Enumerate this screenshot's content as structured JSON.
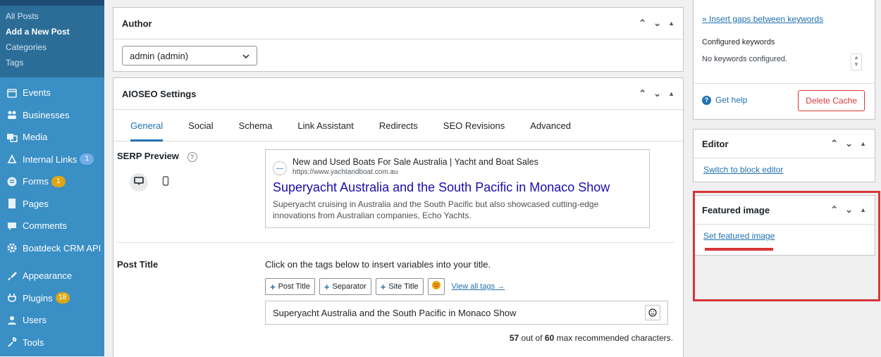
{
  "sidebar": {
    "submenu": [
      "All Posts",
      "Add a New Post",
      "Categories",
      "Tags"
    ],
    "items": [
      {
        "label": "Events",
        "icon": "calendar-icon"
      },
      {
        "label": "Businesses",
        "icon": "businesses-icon"
      },
      {
        "label": "Media",
        "icon": "media-icon"
      },
      {
        "label": "Internal Links",
        "icon": "link-icon",
        "badge": "1"
      },
      {
        "label": "Forms",
        "icon": "forms-icon",
        "badge": "1"
      },
      {
        "label": "Pages",
        "icon": "pages-icon"
      },
      {
        "label": "Comments",
        "icon": "comments-icon"
      },
      {
        "label": "Boatdeck CRM API",
        "icon": "gear-icon"
      },
      {
        "label": "Appearance",
        "icon": "brush-icon"
      },
      {
        "label": "Plugins",
        "icon": "plugin-icon",
        "badge": "18"
      },
      {
        "label": "Users",
        "icon": "users-icon"
      },
      {
        "label": "Tools",
        "icon": "wrench-icon"
      }
    ]
  },
  "author": {
    "title": "Author",
    "selected": "admin (admin)"
  },
  "aioseo": {
    "title": "AIOSEO Settings",
    "tabs": [
      "General",
      "Social",
      "Schema",
      "Link Assistant",
      "Redirects",
      "SEO Revisions",
      "Advanced"
    ],
    "serp_label": "SERP Preview",
    "serp": {
      "site_name": "New and Used Boats For Sale Australia | Yacht and Boat Sales",
      "url": "https://www.yachtandboat.com.au",
      "title": "Superyacht Australia and the South Pacific in Monaco Show",
      "description": "Superyacht cruising in Australia and the South Pacific but also showcased cutting-edge innovations from Australian companies, Echo Yachts."
    },
    "post_title_label": "Post Title",
    "post_title_help": "Click on the tags below to insert variables into your title.",
    "tag_buttons": [
      "Post Title",
      "Separator",
      "Site Title"
    ],
    "view_all_tags": "View all tags →",
    "post_title_value": "Superyacht Australia and the South Pacific in Monaco Show",
    "char_count": "57",
    "char_max": "60",
    "char_text_mid": " out of ",
    "char_text_end": " max recommended characters."
  },
  "right": {
    "insert_gaps": "» Insert gaps between keywords",
    "configured_keywords": "Configured keywords",
    "no_keywords": "No keywords configured.",
    "get_help": "Get help",
    "delete_cache": "Delete Cache",
    "editor_title": "Editor",
    "switch_editor": "Switch to block editor",
    "featured_title": "Featured image",
    "set_featured": "Set featured image"
  },
  "colors": {
    "sidebar_bg": "#3a8fc4",
    "link": "#2271b1",
    "highlight": "#d63638"
  }
}
